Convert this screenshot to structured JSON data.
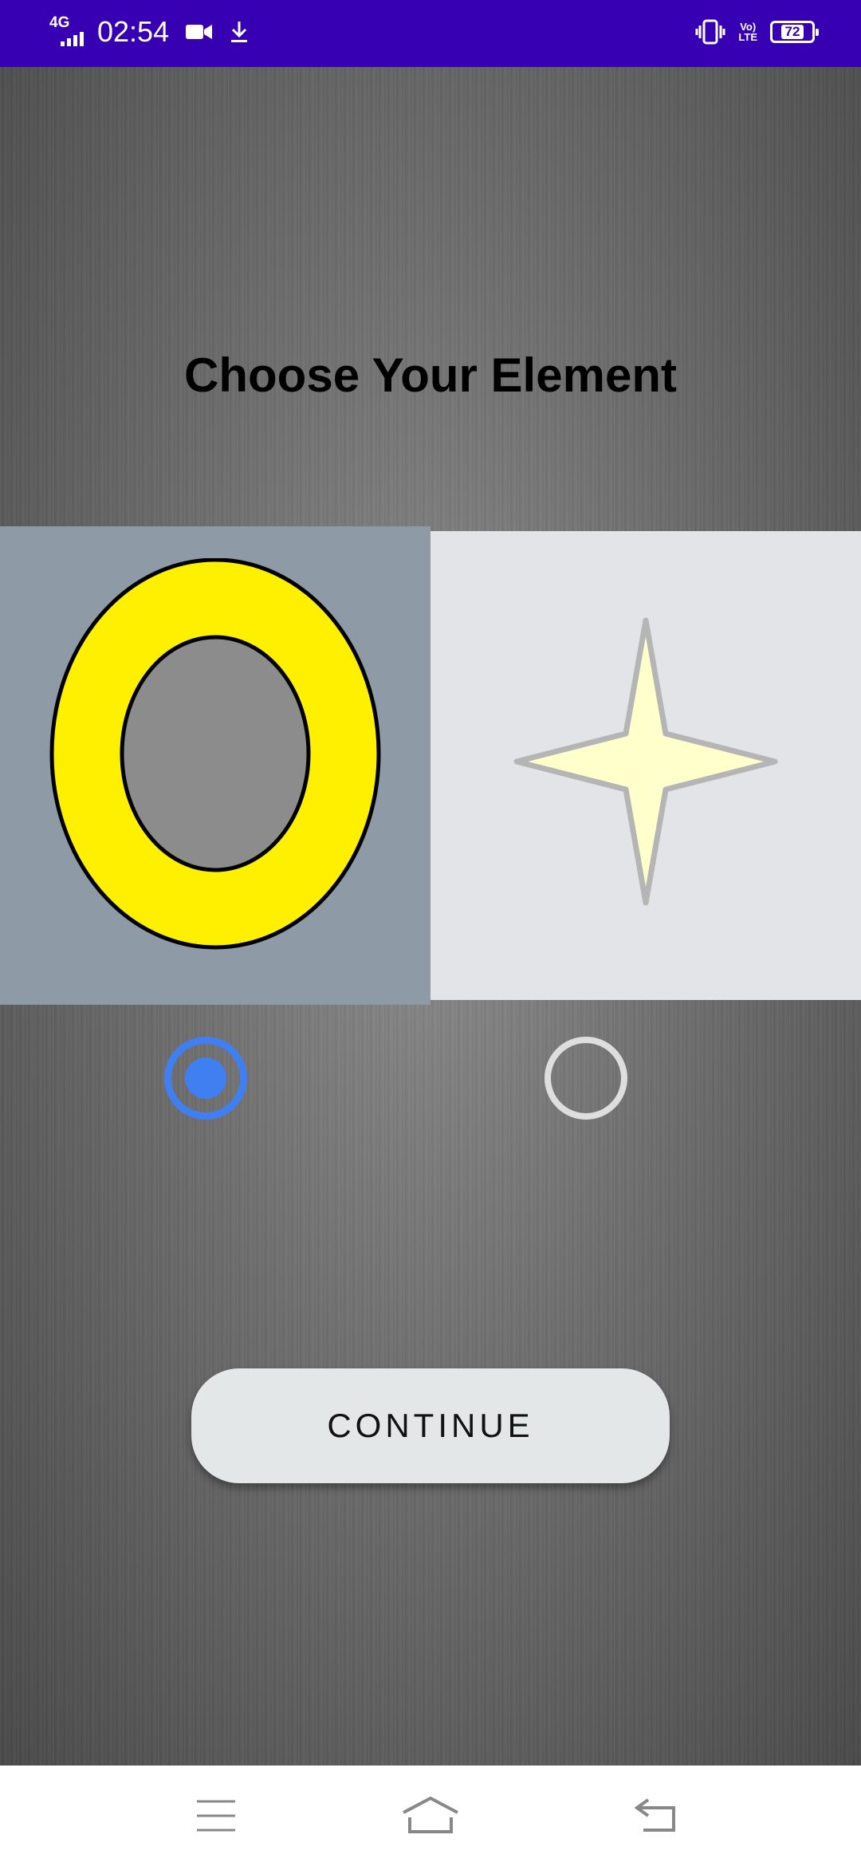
{
  "status_bar": {
    "network": "4G",
    "time": "02:54",
    "volte": "Vo LTE",
    "battery": "72",
    "icons": [
      "signal-icon",
      "video-camera-icon",
      "download-icon",
      "vibrate-icon",
      "volte-icon",
      "battery-icon"
    ]
  },
  "screen": {
    "title": "Choose Your Element",
    "options": [
      {
        "icon": "yellow-ring-icon",
        "selected": true,
        "background": "#8f9aa7"
      },
      {
        "icon": "four-point-star-icon",
        "selected": false,
        "background": "#e3e4e8"
      }
    ],
    "continue_label": "CONTINUE"
  },
  "nav_bar": {
    "icons": [
      "menu-icon",
      "home-icon",
      "back-icon"
    ]
  },
  "colors": {
    "status_bar": "#3700b3",
    "radio_selected": "#3f7ff2",
    "ring_yellow": "#ffff00",
    "star_fill": "#ffffcc"
  }
}
